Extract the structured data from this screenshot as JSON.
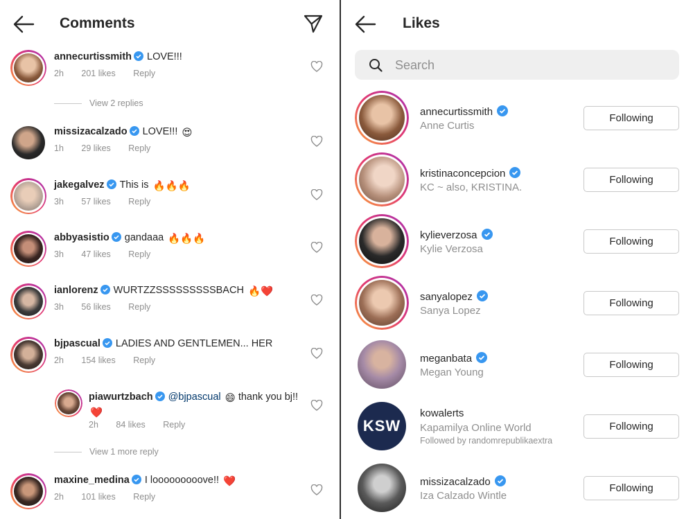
{
  "comments_panel": {
    "title": "Comments",
    "comments": [
      {
        "username": "annecurtissmith",
        "text": "LOVE!!!",
        "time": "2h",
        "likes": "201 likes",
        "reply": "Reply"
      },
      {
        "username": "missizacalzado",
        "text": "LOVE!!!",
        "time": "1h",
        "likes": "29 likes",
        "reply": "Reply",
        "emoji": "😍"
      },
      {
        "username": "jakegalvez",
        "text": "This is",
        "time": "3h",
        "likes": "57 likes",
        "reply": "Reply",
        "emoji": "🔥🔥🔥"
      },
      {
        "username": "abbyasistio",
        "text": "gandaaa",
        "time": "3h",
        "likes": "47 likes",
        "reply": "Reply",
        "emoji": "🔥🔥🔥"
      },
      {
        "username": "ianlorenz",
        "text": "WURTZZSSSSSSSSSBACH",
        "time": "3h",
        "likes": "56 likes",
        "reply": "Reply",
        "emoji": "🔥❤️"
      },
      {
        "username": "bjpascual",
        "text": "LADIES AND GENTLEMEN... HER",
        "time": "2h",
        "likes": "154 likes",
        "reply": "Reply"
      },
      {
        "username": "piawurtzbach",
        "mention": "@bjpascual",
        "text": "thank you bj!!",
        "time": "2h",
        "likes": "84 likes",
        "reply": "Reply",
        "emoji_mid": "😄",
        "emoji": "❤️"
      },
      {
        "username": "maxine_medina",
        "text": "I looooooooove!!",
        "time": "2h",
        "likes": "101 likes",
        "reply": "Reply",
        "emoji": "❤️"
      }
    ],
    "view_replies_1": "View 2 replies",
    "view_replies_2": "View 1 more reply"
  },
  "likes_panel": {
    "title": "Likes",
    "search": {
      "placeholder": "Search"
    },
    "users": [
      {
        "username": "annecurtissmith",
        "name": "Anne Curtis",
        "button": "Following"
      },
      {
        "username": "kristinaconcepcion",
        "name": "KC ~ also, KRISTINA.",
        "button": "Following"
      },
      {
        "username": "kylieverzosa",
        "name": "Kylie Verzosa",
        "button": "Following"
      },
      {
        "username": "sanyalopez",
        "name": "Sanya Lopez",
        "button": "Following"
      },
      {
        "username": "meganbata",
        "name": "Megan Young",
        "button": "Following"
      },
      {
        "username": "kowalerts",
        "name": "Kapamilya Online World",
        "followed_by": "Followed by randomrepublikaextra",
        "button": "Following",
        "logo_text": "KSW"
      },
      {
        "username": "missizacalzado",
        "name": "Iza Calzado Wintle",
        "button": "Following"
      }
    ]
  },
  "colors": {
    "verified": "#3897f0",
    "text": "#262626",
    "muted": "#8e8e8e",
    "search_bg": "#efefef"
  }
}
